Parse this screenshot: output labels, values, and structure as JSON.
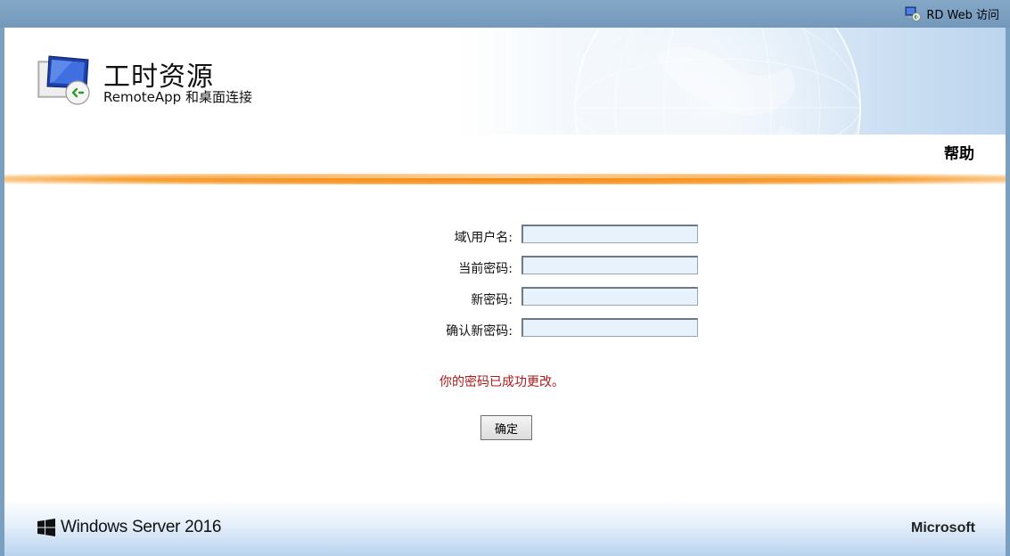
{
  "top_bar": {
    "rd_web_label": "RD Web 访问"
  },
  "header": {
    "title": "工时资源",
    "subtitle": "RemoteApp 和桌面连接",
    "help_label": "帮助"
  },
  "form": {
    "fields": [
      {
        "label": "域\\用户名:",
        "value": ""
      },
      {
        "label": "当前密码:",
        "value": ""
      },
      {
        "label": "新密码:",
        "value": ""
      },
      {
        "label": "确认新密码:",
        "value": ""
      }
    ],
    "status_message": "你的密码已成功更改。",
    "submit_label": "确定"
  },
  "footer": {
    "product": "Windows Server 2016",
    "vendor": "Microsoft"
  },
  "colors": {
    "accent_orange": "#f48a15",
    "status_error_red": "#b01818",
    "input_bg": "#e8f2fd"
  }
}
